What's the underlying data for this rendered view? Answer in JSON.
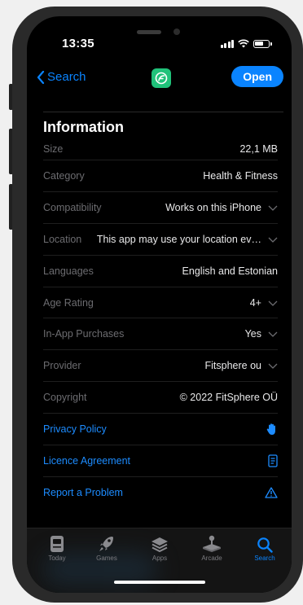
{
  "status": {
    "time": "13:35"
  },
  "nav": {
    "back_label": "Search",
    "open_label": "Open"
  },
  "section": {
    "title": "Information"
  },
  "info_rows": [
    {
      "label": "Size",
      "value": "22,1 MB",
      "chevron": false
    },
    {
      "label": "Category",
      "value": "Health & Fitness",
      "chevron": false
    },
    {
      "label": "Compatibility",
      "value": "Works on this iPhone",
      "chevron": true
    },
    {
      "label": "Location",
      "value": "This app may use your location ev…",
      "chevron": true
    },
    {
      "label": "Languages",
      "value": "English and Estonian",
      "chevron": false
    },
    {
      "label": "Age Rating",
      "value": "4+",
      "chevron": true
    },
    {
      "label": "In-App Purchases",
      "value": "Yes",
      "chevron": true
    },
    {
      "label": "Provider",
      "value": "Fitsphere ou",
      "chevron": true
    },
    {
      "label": "Copyright",
      "value": "© 2022 FitSphere OÜ",
      "chevron": false
    }
  ],
  "links": [
    {
      "label": "Privacy Policy",
      "icon": "hand-icon"
    },
    {
      "label": "Licence Agreement",
      "icon": "document-icon"
    },
    {
      "label": "Report a Problem",
      "icon": "warning-icon"
    }
  ],
  "tabs": [
    {
      "label": "Today",
      "icon": "today-icon",
      "active": false
    },
    {
      "label": "Games",
      "icon": "rocket-icon",
      "active": false
    },
    {
      "label": "Apps",
      "icon": "apps-stack-icon",
      "active": false
    },
    {
      "label": "Arcade",
      "icon": "joystick-icon",
      "active": false
    },
    {
      "label": "Search",
      "icon": "search-icon",
      "active": true
    }
  ],
  "colors": {
    "accent": "#0a84ff",
    "app_icon": "#20c27a"
  }
}
